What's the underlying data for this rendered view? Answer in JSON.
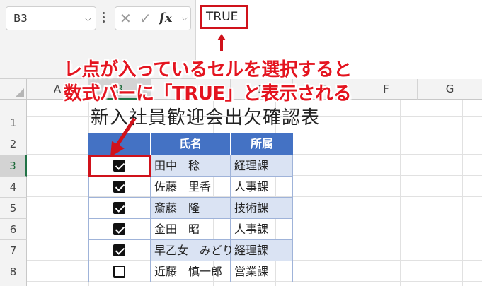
{
  "name_box": {
    "value": "B3"
  },
  "formula_bar": {
    "value": "TRUE"
  },
  "callout": {
    "line1": "レ点が入っているセルを選択すると",
    "line2": "数式バーに「TRUE」と表示される"
  },
  "columns": [
    "A",
    "B",
    "C",
    "D",
    "E",
    "F",
    "G"
  ],
  "rows": [
    "1",
    "2",
    "3",
    "4",
    "5",
    "6",
    "7",
    "8"
  ],
  "sheet": {
    "title": "新入社員歓迎会出欠確認表",
    "headers": {
      "check": "",
      "name": "氏名",
      "dept": "所属"
    },
    "records": [
      {
        "checked": true,
        "name": "田中　稔",
        "dept": "経理課"
      },
      {
        "checked": true,
        "name": "佐藤　里香",
        "dept": "人事課"
      },
      {
        "checked": true,
        "name": "斎藤　隆",
        "dept": "技術課"
      },
      {
        "checked": true,
        "name": "金田　昭",
        "dept": "人事課"
      },
      {
        "checked": true,
        "name": "早乙女　みどり",
        "dept": "経理課"
      },
      {
        "checked": false,
        "name": "近藤　慎一郎",
        "dept": "営業課"
      }
    ]
  },
  "colors": {
    "accent": "#d0121b",
    "header_fill": "#4472c4",
    "alt_fill": "#dae3f3",
    "excel_green": "#217346"
  }
}
